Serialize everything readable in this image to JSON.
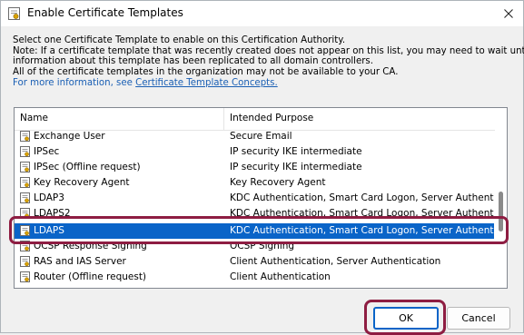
{
  "window": {
    "title": "Enable Certificate Templates"
  },
  "description": {
    "line1": "Select one Certificate Template to enable on this Certification Authority.",
    "line2": "Note: If a certificate template that was recently created does not appear on this list, you may need to wait until",
    "line3": "information about this template has been replicated to all domain controllers.",
    "line4": "All of the certificate templates in the organization may not be available to your CA.",
    "more_prefix": "For more information, see ",
    "link_text": "Certificate Template Concepts."
  },
  "list": {
    "columns": {
      "name": "Name",
      "purpose": "Intended Purpose"
    },
    "rows": [
      {
        "name": "Exchange User",
        "purpose": "Secure Email"
      },
      {
        "name": "IPSec",
        "purpose": "IP security IKE intermediate"
      },
      {
        "name": "IPSec (Offline request)",
        "purpose": "IP security IKE intermediate"
      },
      {
        "name": "Key Recovery Agent",
        "purpose": "Key Recovery Agent"
      },
      {
        "name": "LDAP3",
        "purpose": "KDC Authentication, Smart Card Logon, Server Authentication"
      },
      {
        "name": "LDAPS2",
        "purpose": "KDC Authentication, Smart Card Logon, Server Authentication"
      },
      {
        "name": "LDAPS",
        "purpose": "KDC Authentication, Smart Card Logon, Server Authentication",
        "selected": true
      },
      {
        "name": "OCSP Response Signing",
        "purpose": "OCSP Signing"
      },
      {
        "name": "RAS and IAS Server",
        "purpose": "Client Authentication, Server Authentication"
      },
      {
        "name": "Router (Offline request)",
        "purpose": "Client Authentication"
      }
    ]
  },
  "buttons": {
    "ok": "OK",
    "cancel": "Cancel"
  },
  "colors": {
    "selection": "#0a64c8",
    "highlight": "#8e1d42",
    "link": "#1a5fb4"
  }
}
